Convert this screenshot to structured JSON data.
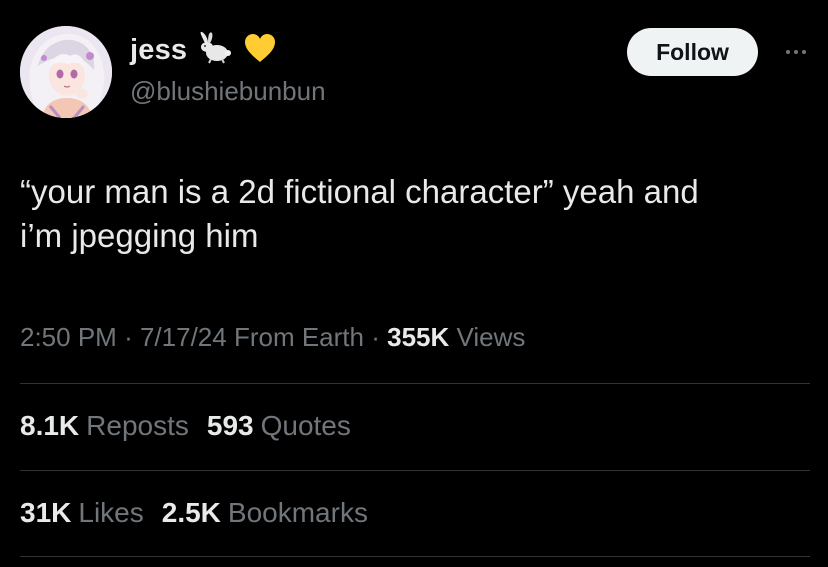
{
  "colors": {
    "background": "#000000",
    "primary_text": "#e7e9ea",
    "secondary_text": "#71767b",
    "divider": "#2f3336",
    "follow_bg": "#eff3f4",
    "follow_text": "#0f1419"
  },
  "author": {
    "display_name": "jess",
    "emojis": [
      "rabbit-icon",
      "yellow-heart-icon"
    ],
    "handle": "@blushiebunbun",
    "avatar_icon": "anime-avatar"
  },
  "actions": {
    "follow_label": "Follow",
    "more_icon": "more-options-icon"
  },
  "tweet": {
    "text_line1": "“your man is a 2d fictional character” yeah and",
    "text_line2": "i’m jpegging him"
  },
  "meta": {
    "time": "2:50 PM",
    "sep1": "·",
    "date": "7/17/24",
    "source": "From Earth",
    "sep2": "·",
    "views_count": "355K",
    "views_label": "Views"
  },
  "stats": {
    "reposts_count": "8.1K",
    "reposts_label": "Reposts",
    "quotes_count": "593",
    "quotes_label": "Quotes",
    "likes_count": "31K",
    "likes_label": "Likes",
    "bookmarks_count": "2.5K",
    "bookmarks_label": "Bookmarks"
  }
}
